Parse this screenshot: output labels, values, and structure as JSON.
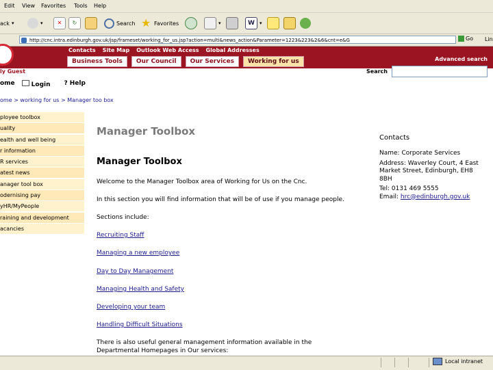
{
  "menu": [
    "Edit",
    "View",
    "Favorites",
    "Tools",
    "Help"
  ],
  "toolbar": {
    "back_fragment": "ack",
    "search_label": "Search",
    "favorites_label": "Favorites"
  },
  "address": {
    "value": "http://cnc.intra.edinburgh.gov.uk/jsp/frameset/working_for_us.jsp?action=multi&news_action&Parameter=1223&223&2&6&cnt=e&G",
    "go_label": "Go",
    "links_label": "Links"
  },
  "banner": {
    "top_links": [
      "Contacts",
      "Site Map",
      "Outlook Web Access",
      "Global Addresses"
    ],
    "tabs": [
      "Business Tools",
      "Our Council",
      "Our Services",
      "Working for us"
    ],
    "advanced_search": "Advanced search"
  },
  "guest": "ly Guest",
  "search_label": "Search",
  "nav": [
    "ome",
    "Login",
    "Help"
  ],
  "breadcrumb": "ome > working for us > Manager too box",
  "sidebar": [
    "ployee toolbox",
    "uality",
    "ealth and well being",
    "r information",
    "R services",
    "atest news",
    "anager tool box",
    "odernising pay",
    "yHR/MyPeople",
    "raining and development",
    "acancies"
  ],
  "main": {
    "heading": "Manager Toolbox",
    "subheading": "Manager Toolbox",
    "welcome": "Welcome to the Manager Toolbox area of Working for Us on the Cnc.",
    "intro": "In this section you will find information that will be of use if you manage people.",
    "sections_label": "Sections include:",
    "links": [
      "Recruiting Staff",
      "Managing a new employee",
      "Day to Day Management",
      "Managing Health and Safety",
      "Developing your team",
      "Handling Difficult Situations"
    ],
    "footer_line1": "There is also useful general management information available in the",
    "footer_line2": "Departmental Homepages in Our services:"
  },
  "contacts": {
    "title": "Contacts",
    "lines": [
      "Name: Corporate Services",
      "Address: Waverley Court, 4 East",
      "Market Street, Edinburgh, EH8",
      "8BH",
      "Tel: 0131 469 5555"
    ],
    "email_label": "Email:",
    "email": "hrc@edinburgh.gov.uk"
  },
  "status": {
    "zone": "Local intranet"
  }
}
